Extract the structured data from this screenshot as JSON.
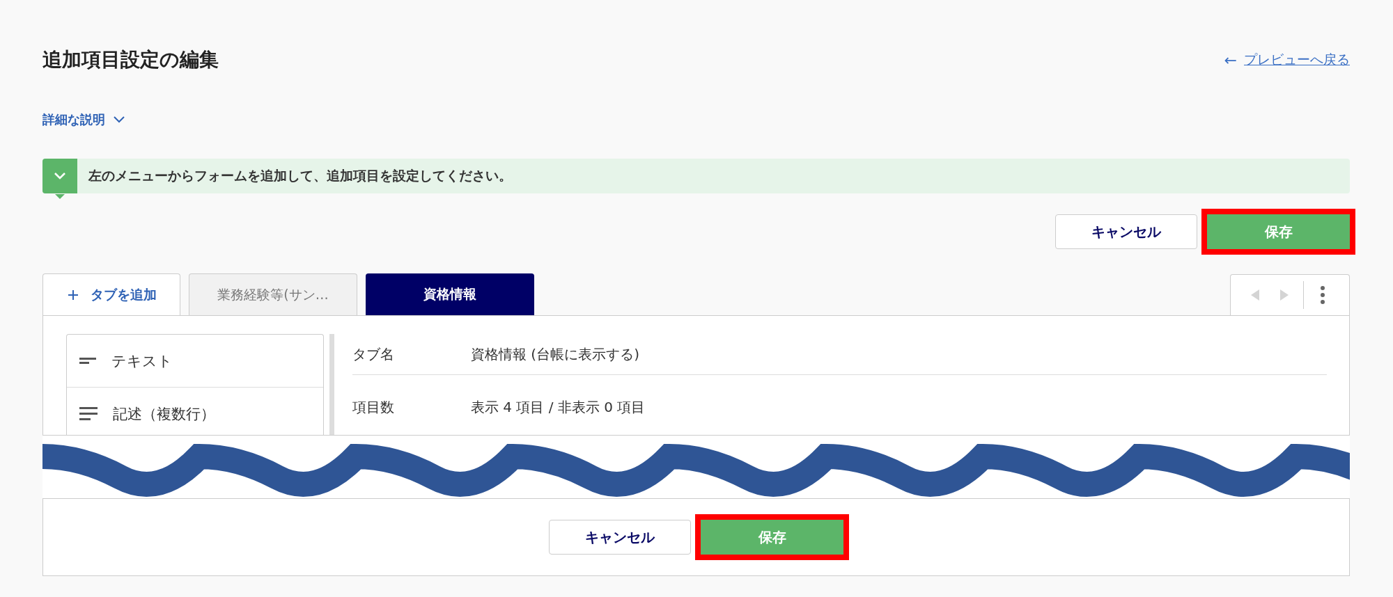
{
  "header": {
    "title": "追加項目設定の編集",
    "back_link": {
      "arrow": "←",
      "label": "プレビューへ戻る"
    }
  },
  "details_toggle": {
    "label": "詳細な説明",
    "expanded": false
  },
  "notice": {
    "text": "左のメニューからフォームを追加して、追加項目を設定してください。",
    "expanded": false
  },
  "top_actions": [
    {
      "kind": "secondary",
      "label": "キャンセル",
      "highlighted": false
    },
    {
      "kind": "primary",
      "label": "保存",
      "highlighted": true
    }
  ],
  "add_tab": {
    "label": "タブを追加"
  },
  "tabs": [
    {
      "label": "業務経験等(サン…",
      "selected": false
    },
    {
      "label": "資格情報",
      "selected": true
    }
  ],
  "tab_nav": {
    "prev_disabled": true,
    "next_disabled": true
  },
  "form_menu": [
    {
      "kind": "short",
      "label": "テキスト"
    },
    {
      "kind": "long",
      "label": "記述（複数行）"
    }
  ],
  "tab_info": [
    {
      "label": "タブ名",
      "value": "資格情報 (台帳に表示する)"
    },
    {
      "label": "項目数",
      "value": "表示 4 項目 / 非表示 0 項目"
    }
  ],
  "bottom_actions": [
    {
      "kind": "secondary",
      "label": "キャンセル",
      "highlighted": false
    },
    {
      "kind": "primary",
      "label": "保存",
      "highlighted": true
    }
  ]
}
